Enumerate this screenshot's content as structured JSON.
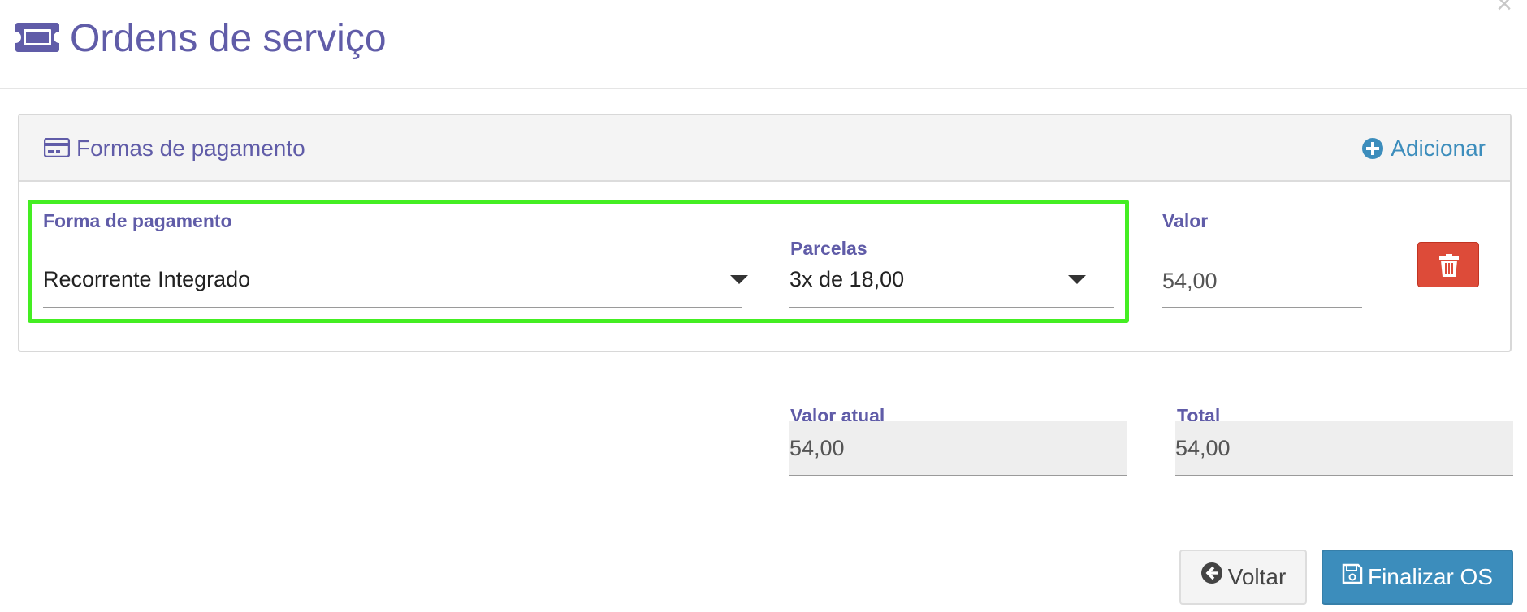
{
  "modal": {
    "title": "Ordens de serviço",
    "close_label": "×"
  },
  "panel": {
    "heading": "Formas de pagamento",
    "add_label": "Adicionar"
  },
  "payment_row": {
    "method_label": "Forma de pagamento",
    "method_value": "Recorrente Integrado",
    "installments_label": "Parcelas",
    "installments_value": "3x de 18,00",
    "amount_label": "Valor",
    "amount_value": "54,00"
  },
  "summary": {
    "current_label": "Valor atual",
    "current_value": "54,00",
    "total_label": "Total",
    "total_value": "54,00"
  },
  "footer": {
    "back_label": "Voltar",
    "finish_label": "Finalizar OS"
  },
  "colors": {
    "accent_purple": "#605ca8",
    "primary_blue": "#3c8dbc",
    "danger_red": "#dd4b39",
    "highlight_green": "#44ee22"
  }
}
